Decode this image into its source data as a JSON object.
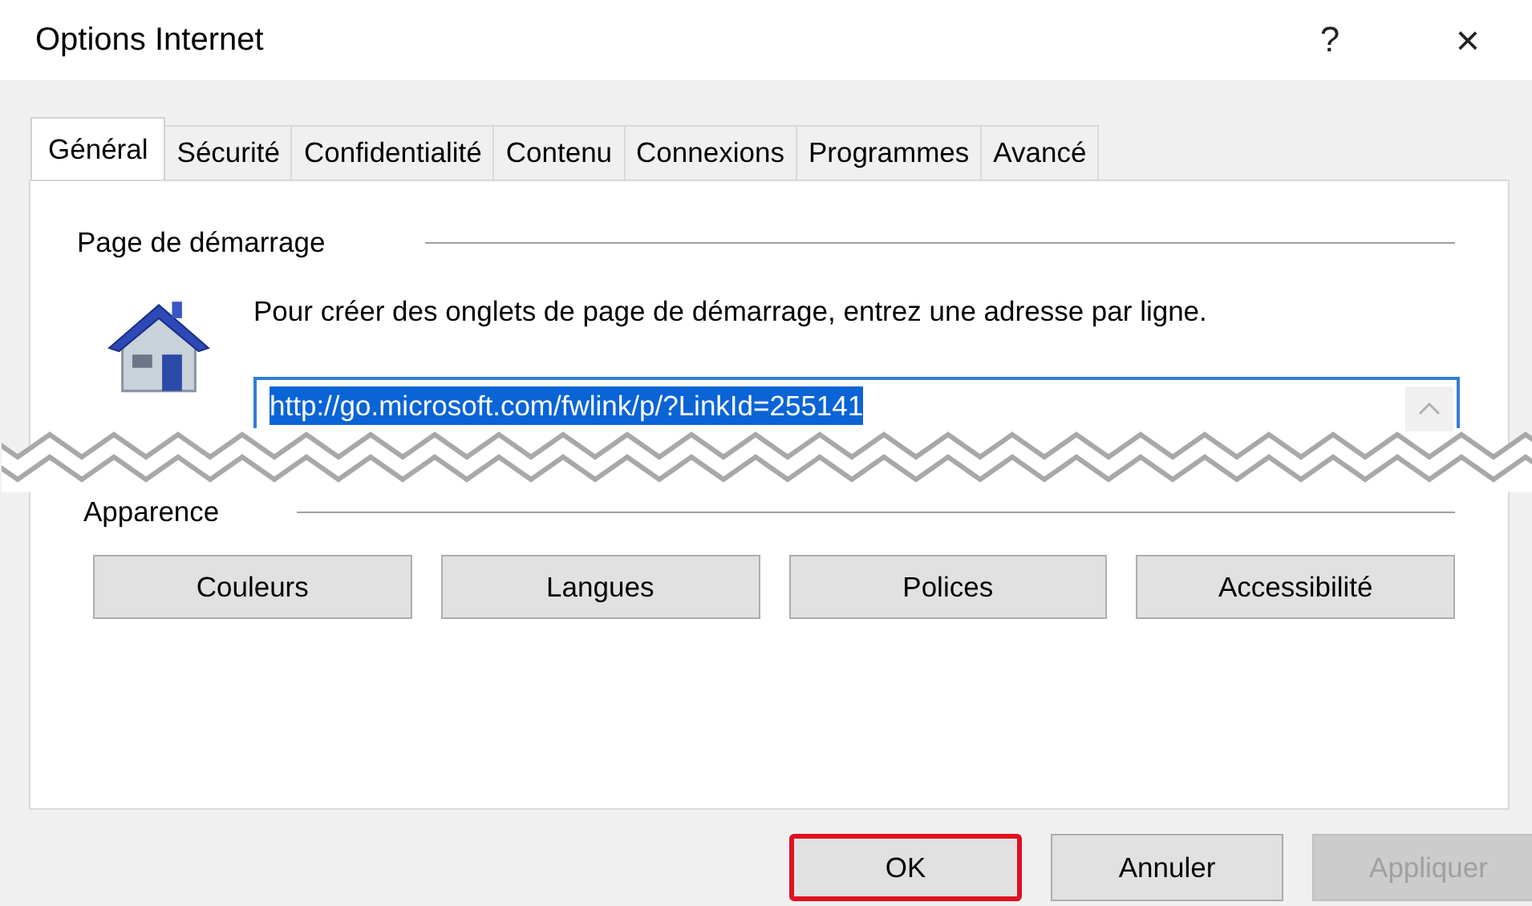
{
  "window": {
    "title": "Options Internet",
    "help": "?",
    "close": "×"
  },
  "tabs": [
    {
      "label": "Général",
      "selected": true
    },
    {
      "label": "Sécurité",
      "selected": false
    },
    {
      "label": "Confidentialité",
      "selected": false
    },
    {
      "label": "Contenu",
      "selected": false
    },
    {
      "label": "Connexions",
      "selected": false
    },
    {
      "label": "Programmes",
      "selected": false
    },
    {
      "label": "Avancé",
      "selected": false
    }
  ],
  "start_page": {
    "title": "Page de démarrage",
    "description": "Pour créer des onglets de page de démarrage, entrez une adresse par ligne.",
    "url": "http://go.microsoft.com/fwlink/p/?LinkId=255141",
    "url_selected": true
  },
  "appearance": {
    "title": "Apparence",
    "buttons": [
      "Couleurs",
      "Langues",
      "Polices",
      "Accessibilité"
    ]
  },
  "buttons": [
    {
      "label": "OK",
      "highlighted": true,
      "disabled": false
    },
    {
      "label": "Annuler",
      "highlighted": false,
      "disabled": false
    },
    {
      "label": "Appliquer",
      "highlighted": false,
      "disabled": true
    }
  ]
}
